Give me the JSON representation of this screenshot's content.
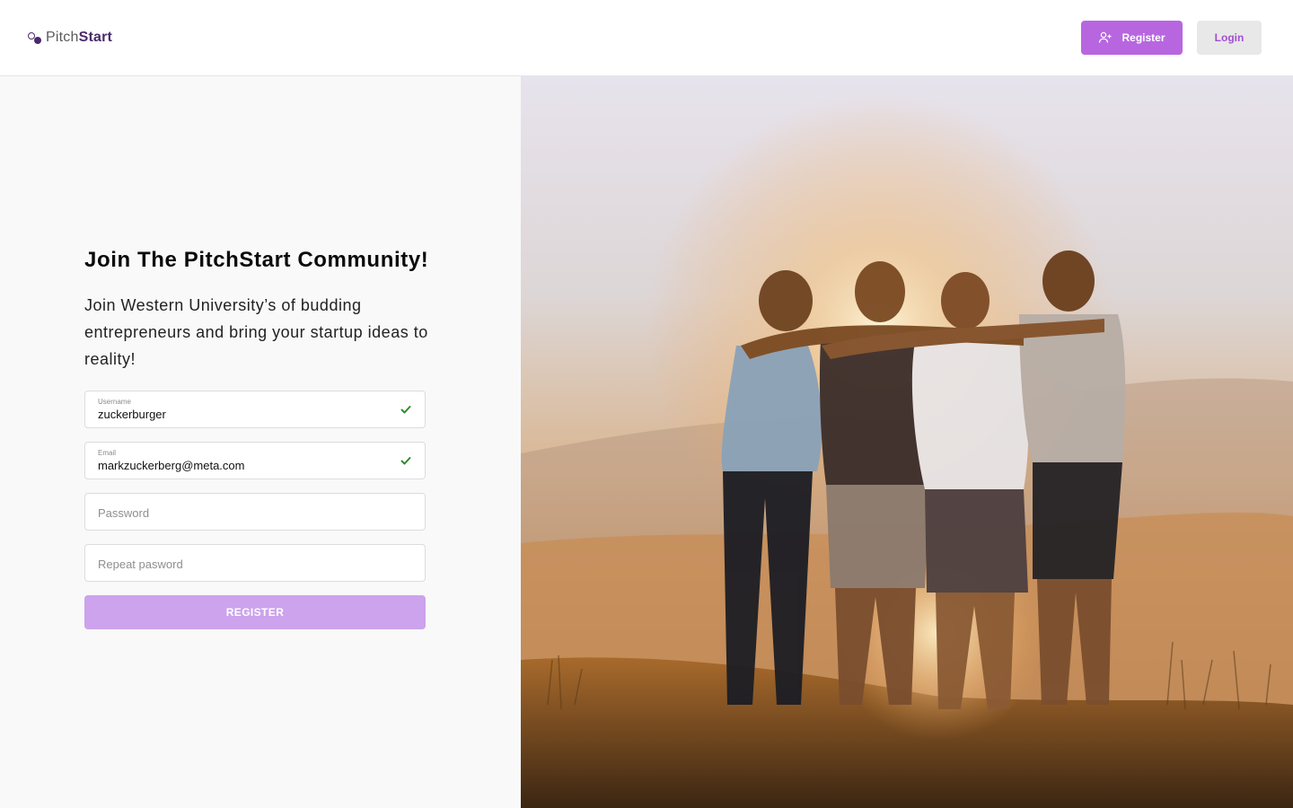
{
  "header": {
    "logo_part1": "Pitch",
    "logo_part2": "Start",
    "register_label": "Register",
    "login_label": "Login",
    "icons": {
      "register": "user-plus-icon"
    }
  },
  "form": {
    "title": "Join The PitchStart Community!",
    "subtitle": "Join Western University’s of budding entrepreneurs and bring your startup ideas to reality!",
    "username": {
      "label": "Username",
      "value": "zuckerburger",
      "valid": true
    },
    "email": {
      "label": "Email",
      "value": "markzuckerberg@meta.com",
      "valid": true
    },
    "password": {
      "placeholder": "Password",
      "value": ""
    },
    "repeat_password": {
      "placeholder": "Repeat pasword",
      "value": ""
    },
    "submit_label": "REGISTER",
    "submit_state": "disabled"
  },
  "hero": {
    "icon": "group-of-friends-sunset-photo"
  },
  "colors": {
    "accent": "#b866e0",
    "accent_disabled": "#cca3ec",
    "logo": "#4a2a6a",
    "valid": "#2e8b2e",
    "panel_bg": "#f9f9f9"
  }
}
